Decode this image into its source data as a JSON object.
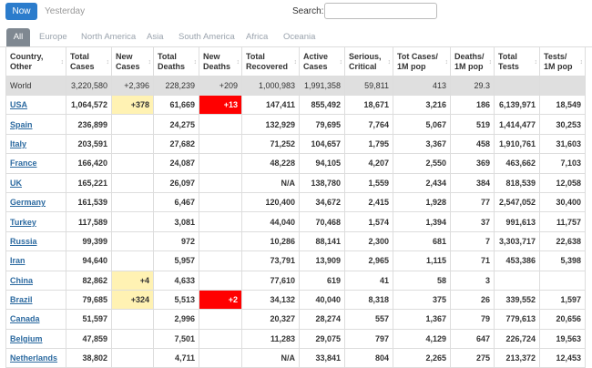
{
  "topbar": {
    "now": "Now",
    "yesterday": "Yesterday",
    "search_label": "Search:",
    "search_value": ""
  },
  "tabs": [
    "All",
    "Europe",
    "North America",
    "Asia",
    "South America",
    "Africa",
    "Oceania"
  ],
  "columns": [
    "Country,\nOther",
    "Total\nCases",
    "New\nCases",
    "Total\nDeaths",
    "New\nDeaths",
    "Total\nRecovered",
    "Active\nCases",
    "Serious,\nCritical",
    "Tot Cases/\n1M pop",
    "Deaths/\n1M pop",
    "Total\nTests",
    "Tests/\n1M pop"
  ],
  "world": [
    "World",
    "3,220,580",
    "+2,396",
    "228,239",
    "+209",
    "1,000,983",
    "1,991,358",
    "59,811",
    "413",
    "29.3",
    "",
    ""
  ],
  "rows": [
    [
      "USA",
      "1,064,572",
      "+378",
      "61,669",
      "+13",
      "147,411",
      "855,492",
      "18,671",
      "3,216",
      "186",
      "6,139,971",
      "18,549"
    ],
    [
      "Spain",
      "236,899",
      "",
      "24,275",
      "",
      "132,929",
      "79,695",
      "7,764",
      "5,067",
      "519",
      "1,414,477",
      "30,253"
    ],
    [
      "Italy",
      "203,591",
      "",
      "27,682",
      "",
      "71,252",
      "104,657",
      "1,795",
      "3,367",
      "458",
      "1,910,761",
      "31,603"
    ],
    [
      "France",
      "166,420",
      "",
      "24,087",
      "",
      "48,228",
      "94,105",
      "4,207",
      "2,550",
      "369",
      "463,662",
      "7,103"
    ],
    [
      "UK",
      "165,221",
      "",
      "26,097",
      "",
      "N/A",
      "138,780",
      "1,559",
      "2,434",
      "384",
      "818,539",
      "12,058"
    ],
    [
      "Germany",
      "161,539",
      "",
      "6,467",
      "",
      "120,400",
      "34,672",
      "2,415",
      "1,928",
      "77",
      "2,547,052",
      "30,400"
    ],
    [
      "Turkey",
      "117,589",
      "",
      "3,081",
      "",
      "44,040",
      "70,468",
      "1,574",
      "1,394",
      "37",
      "991,613",
      "11,757"
    ],
    [
      "Russia",
      "99,399",
      "",
      "972",
      "",
      "10,286",
      "88,141",
      "2,300",
      "681",
      "7",
      "3,303,717",
      "22,638"
    ],
    [
      "Iran",
      "94,640",
      "",
      "5,957",
      "",
      "73,791",
      "13,909",
      "2,965",
      "1,115",
      "71",
      "453,386",
      "5,398"
    ],
    [
      "China",
      "82,862",
      "+4",
      "4,633",
      "",
      "77,610",
      "619",
      "41",
      "58",
      "3",
      "",
      ""
    ],
    [
      "Brazil",
      "79,685",
      "+324",
      "5,513",
      "+2",
      "34,132",
      "40,040",
      "8,318",
      "375",
      "26",
      "339,552",
      "1,597"
    ],
    [
      "Canada",
      "51,597",
      "",
      "2,996",
      "",
      "20,327",
      "28,274",
      "557",
      "1,367",
      "79",
      "779,613",
      "20,656"
    ],
    [
      "Belgium",
      "47,859",
      "",
      "7,501",
      "",
      "11,283",
      "29,075",
      "797",
      "4,129",
      "647",
      "226,724",
      "19,563"
    ],
    [
      "Netherlands",
      "38,802",
      "",
      "4,711",
      "",
      "N/A",
      "33,841",
      "804",
      "2,265",
      "275",
      "213,372",
      "12,453"
    ]
  ],
  "highlight_colors": {
    "new_cases": "#fff2b3",
    "new_deaths": "#ff0000",
    "world_row": "#dfdfdf",
    "link": "#2c6aa0",
    "active_tab": "#7f8891",
    "now_button": "#2b7ccc"
  }
}
